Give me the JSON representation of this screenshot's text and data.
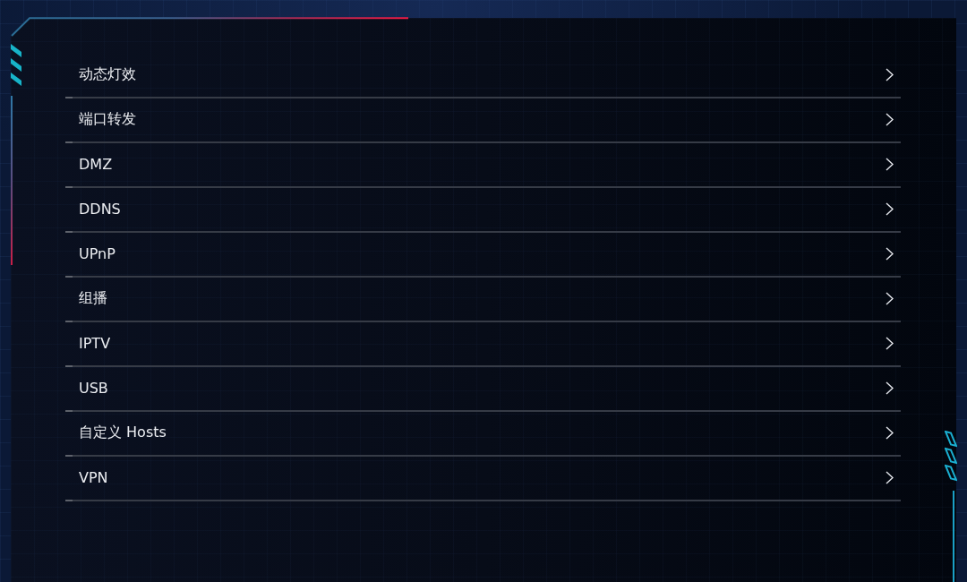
{
  "menu": {
    "items": [
      {
        "label": "动态灯效"
      },
      {
        "label": "端口转发"
      },
      {
        "label": "DMZ"
      },
      {
        "label": "DDNS"
      },
      {
        "label": "UPnP"
      },
      {
        "label": "组播"
      },
      {
        "label": "IPTV"
      },
      {
        "label": "USB"
      },
      {
        "label": "自定义 Hosts"
      },
      {
        "label": "VPN"
      }
    ]
  }
}
